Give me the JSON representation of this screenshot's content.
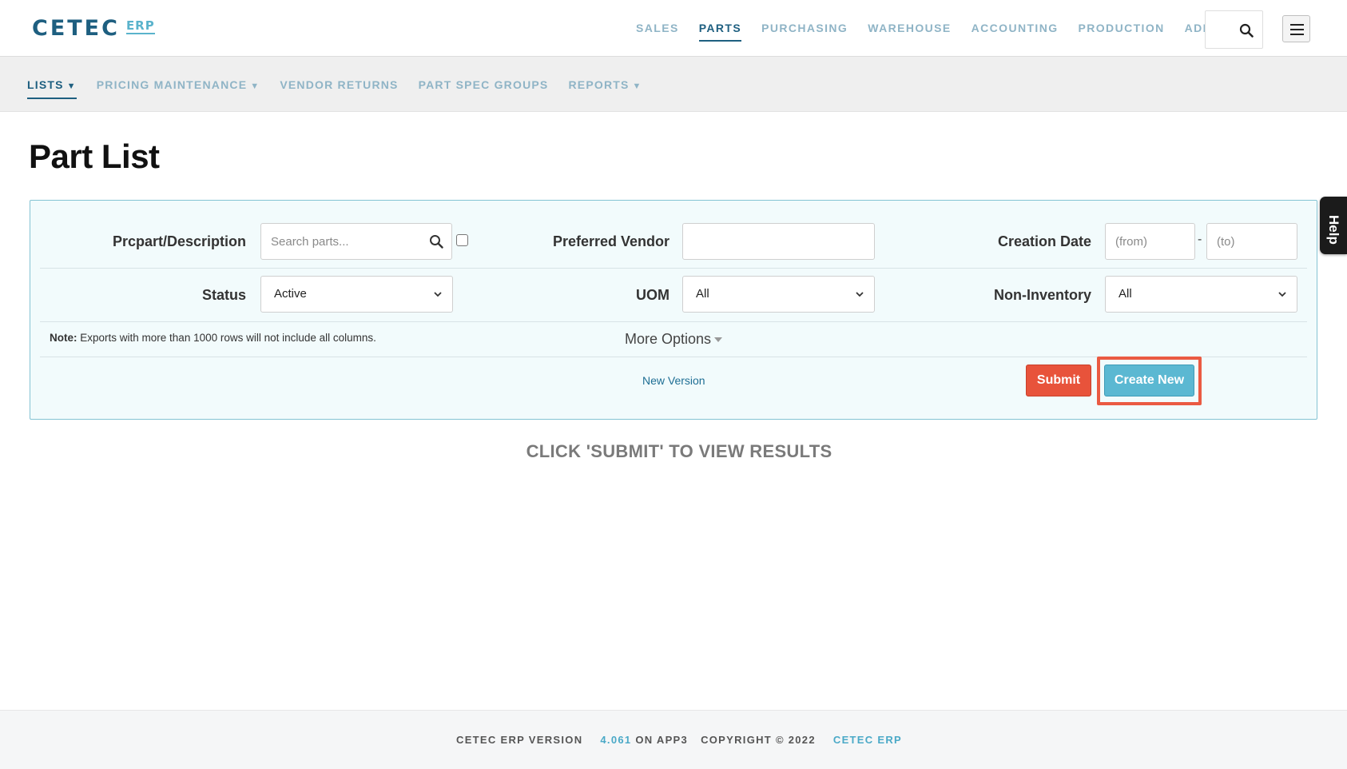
{
  "brand": {
    "name": "CETEC",
    "suffix": "ERP"
  },
  "main_nav": [
    {
      "label": "SALES",
      "active": false
    },
    {
      "label": "PARTS",
      "active": true
    },
    {
      "label": "PURCHASING",
      "active": false
    },
    {
      "label": "WAREHOUSE",
      "active": false
    },
    {
      "label": "ACCOUNTING",
      "active": false
    },
    {
      "label": "PRODUCTION",
      "active": false
    },
    {
      "label": "ADMIN",
      "active": false
    }
  ],
  "sub_nav": [
    {
      "label": "LISTS",
      "active": true,
      "dropdown": true
    },
    {
      "label": "PRICING MAINTENANCE",
      "active": false,
      "dropdown": true
    },
    {
      "label": "VENDOR RETURNS",
      "active": false,
      "dropdown": false
    },
    {
      "label": "PART SPEC GROUPS",
      "active": false,
      "dropdown": false
    },
    {
      "label": "REPORTS",
      "active": false,
      "dropdown": true
    }
  ],
  "page": {
    "title": "Part List"
  },
  "help": {
    "label": "Help"
  },
  "filters": {
    "prcpart": {
      "label": "Prcpart/Description",
      "placeholder": "Search parts..."
    },
    "preferred_vendor": {
      "label": "Preferred Vendor",
      "value": ""
    },
    "creation_date": {
      "label": "Creation Date",
      "from_placeholder": "(from)",
      "to_placeholder": "(to)",
      "separator": "-"
    },
    "status": {
      "label": "Status",
      "value": "Active"
    },
    "uom": {
      "label": "UOM",
      "value": "All"
    },
    "non_inventory": {
      "label": "Non-Inventory",
      "value": "All"
    }
  },
  "note": {
    "prefix": "Note:",
    "text": "Exports with more than 1000 rows will not include all columns."
  },
  "more_options": "More Options",
  "new_version": "New Version",
  "buttons": {
    "submit": "Submit",
    "create_new": "Create New"
  },
  "results_message": "CLICK 'SUBMIT' TO VIEW RESULTS",
  "footer": {
    "version_label": "CETEC ERP VERSION",
    "version": "4.061",
    "server": "ON APP3",
    "copyright": "COPYRIGHT © 2022",
    "brand": "CETEC ERP"
  },
  "colors": {
    "primary": "#1e5f80",
    "accent": "#5bb8d2",
    "submit": "#e8533b",
    "highlight": "#ea5a42"
  },
  "icons": [
    "search-icon",
    "hamburger-menu-icon",
    "chevron-down-icon",
    "caret-down-icon"
  ]
}
